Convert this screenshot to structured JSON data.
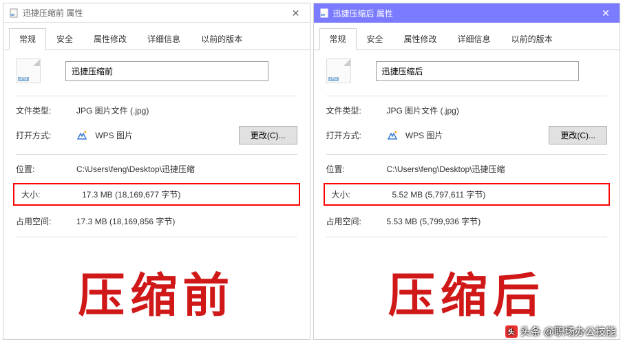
{
  "left": {
    "title": "迅捷压缩前 属性",
    "tabs": [
      "常规",
      "安全",
      "属性修改",
      "详细信息",
      "以前的版本"
    ],
    "active_tab_index": 0,
    "file_icon_badge": "JPG",
    "filename": "迅捷压缩前",
    "file_type_label": "文件类型:",
    "file_type_value": "JPG 图片文件 (.jpg)",
    "open_with_label": "打开方式:",
    "open_with_value": "WPS 图片",
    "change_btn": "更改(C)...",
    "location_label": "位置:",
    "location_value": "C:\\Users\\feng\\Desktop\\迅捷压缩",
    "size_label": "大小:",
    "size_value": "17.3 MB (18,169,677 字节)",
    "disk_label": "占用空间:",
    "disk_value": "17.3 MB (18,169,856 字节)",
    "big_label": "压缩前"
  },
  "right": {
    "title": "迅捷压缩后 属性",
    "tabs": [
      "常规",
      "安全",
      "属性修改",
      "详细信息",
      "以前的版本"
    ],
    "active_tab_index": 0,
    "file_icon_badge": "JPG",
    "filename": "迅捷压缩后",
    "file_type_label": "文件类型:",
    "file_type_value": "JPG 图片文件 (.jpg)",
    "open_with_label": "打开方式:",
    "open_with_value": "WPS 图片",
    "change_btn": "更改(C)...",
    "location_label": "位置:",
    "location_value": "C:\\Users\\feng\\Desktop\\迅捷压缩",
    "size_label": "大小:",
    "size_value": "5.52 MB (5,797,611 字节)",
    "disk_label": "占用空间:",
    "disk_value": "5.53 MB (5,799,936 字节)",
    "big_label": "压缩后"
  },
  "watermark": "头条 @职场办公技能"
}
